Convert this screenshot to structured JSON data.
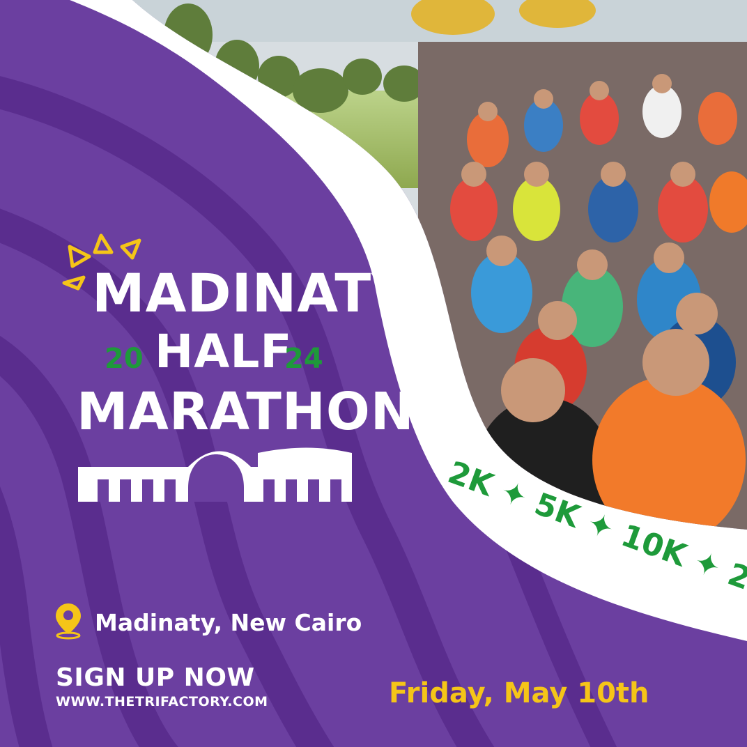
{
  "event": {
    "title_line1": "MADINATY",
    "title_line2": "HALF",
    "title_line3": "MARATHON",
    "year_left": "20",
    "year_right": "24"
  },
  "distances": "2K ✦ 5K ✦ 10K ✦ 2",
  "location": {
    "icon": "location-pin-icon",
    "text": "Madinaty,  New Cairo"
  },
  "cta": {
    "signup": "SIGN UP NOW",
    "website": "WWW.THETRIFACTORY.COM"
  },
  "date": "Friday, May 10th",
  "colors": {
    "background_purple": "#6b3fa0",
    "wave_purple": "#5a2d8e",
    "accent_green": "#1e9a3a",
    "accent_yellow": "#f5c518",
    "white": "#ffffff"
  }
}
